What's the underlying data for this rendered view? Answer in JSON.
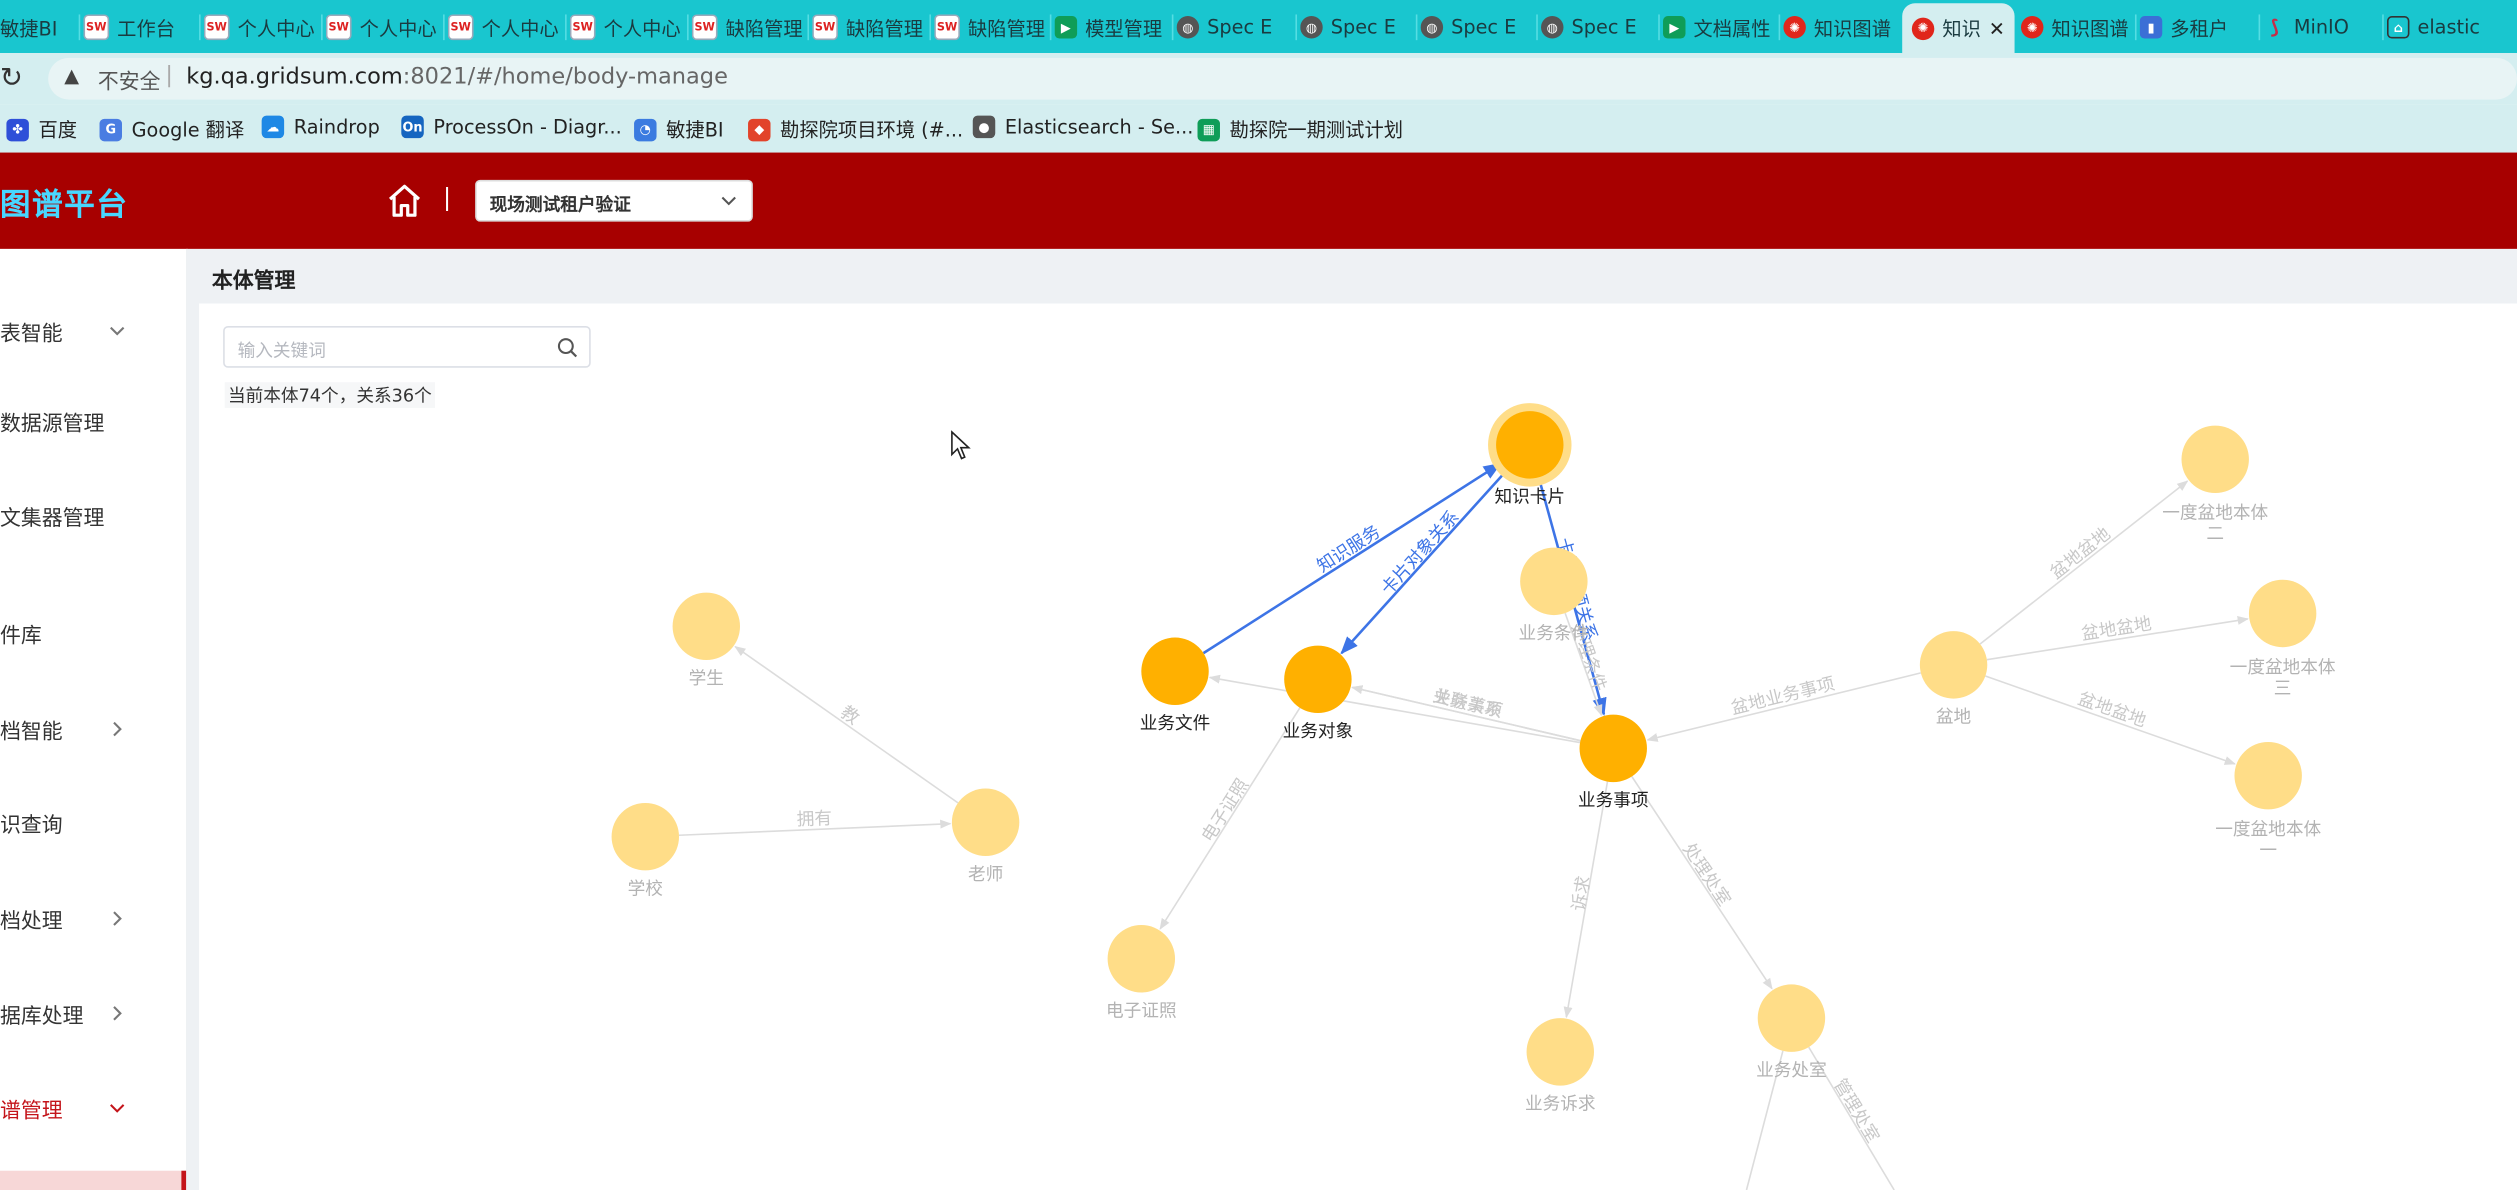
{
  "browser": {
    "tabs": [
      {
        "label": "敏捷BI",
        "icon": "bi-icon"
      },
      {
        "label": "工作台",
        "icon": "gridsum-icon"
      },
      {
        "label": "个人中心",
        "icon": "gridsum-icon"
      },
      {
        "label": "个人中心",
        "icon": "gridsum-icon"
      },
      {
        "label": "个人中心",
        "icon": "gridsum-icon"
      },
      {
        "label": "个人中心",
        "icon": "gridsum-icon"
      },
      {
        "label": "缺陷管理",
        "icon": "gridsum-icon"
      },
      {
        "label": "缺陷管理",
        "icon": "gridsum-icon"
      },
      {
        "label": "缺陷管理",
        "icon": "gridsum-icon"
      },
      {
        "label": "模型管理",
        "icon": "play-icon"
      },
      {
        "label": "Spec E",
        "icon": "globe-icon"
      },
      {
        "label": "Spec E",
        "icon": "globe-icon"
      },
      {
        "label": "Spec E",
        "icon": "globe-icon"
      },
      {
        "label": "Spec E",
        "icon": "globe-icon"
      },
      {
        "label": "文档属性",
        "icon": "play-icon"
      },
      {
        "label": "知识图谱",
        "icon": "petrochina-icon"
      },
      {
        "label": "知识",
        "icon": "petrochina-icon",
        "active": true
      },
      {
        "label": "知识图谱",
        "icon": "petrochina-icon"
      },
      {
        "label": "多租户",
        "icon": "bars-icon"
      },
      {
        "label": "MinIO",
        "icon": "minio-icon"
      },
      {
        "label": "elastic",
        "icon": "elastic-icon"
      }
    ],
    "close_glyph": "✕",
    "reload_glyph": "↻",
    "warning_glyph": "▲",
    "insecure_label": "不安全",
    "url_host": "kg.qa.gridsum.com",
    "url_rest": ":8021/#/home/body-manage",
    "bookmarks": [
      {
        "label": "百度",
        "icon": "baidu-icon"
      },
      {
        "label": "Google 翻译",
        "icon": "google-translate-icon"
      },
      {
        "label": "Raindrop",
        "icon": "raindrop-icon"
      },
      {
        "label": "ProcessOn - Diagr...",
        "icon": "processon-icon"
      },
      {
        "label": "敏捷BI",
        "icon": "bi-icon"
      },
      {
        "label": "勘探院项目环境 (#...",
        "icon": "gitlab-icon"
      },
      {
        "label": "Elasticsearch - Se...",
        "icon": "elasticsearch-icon"
      },
      {
        "label": "勘探院一期测试计划",
        "icon": "sheets-icon"
      }
    ]
  },
  "app": {
    "brand": "图谱平台",
    "home_separator": "|",
    "tenant_selected": "现场测试租户验证"
  },
  "sidebar": {
    "items": [
      {
        "label": "表智能",
        "arrow": "down"
      },
      {
        "label": "数据源管理",
        "arrow": ""
      },
      {
        "label": "文集器管理",
        "arrow": ""
      },
      {
        "label": "件库",
        "arrow": ""
      },
      {
        "label": "档智能",
        "arrow": "right"
      },
      {
        "label": "识查询",
        "arrow": ""
      },
      {
        "label": "档处理",
        "arrow": "right"
      },
      {
        "label": "据库处理",
        "arrow": "right"
      },
      {
        "label": "谱管理",
        "arrow": "down",
        "active": true
      }
    ]
  },
  "main": {
    "page_title": "本体管理",
    "search_placeholder": "输入关键词",
    "count_text": "当前本体74个，关系36个"
  },
  "colors": {
    "header_red": "#a70000",
    "brand_cyan": "#48d7ff",
    "node_active": "#ffb000",
    "node_faded": "#ffdd88",
    "edge_active": "#3d74e6",
    "edge_faded": "#dcdcdc",
    "sidebar_active": "#c4141a"
  },
  "graph": {
    "nodes": [
      {
        "id": "card",
        "label": "知识卡片",
        "active": true,
        "selected": true
      },
      {
        "id": "file",
        "label": "业务文件",
        "active": true
      },
      {
        "id": "object",
        "label": "业务对象",
        "active": true
      },
      {
        "id": "matter",
        "label": "业务事项",
        "active": true
      },
      {
        "id": "condition",
        "label": "业务条件",
        "active": false
      },
      {
        "id": "student",
        "label": "学生",
        "active": false
      },
      {
        "id": "school",
        "label": "学校",
        "active": false
      },
      {
        "id": "teacher",
        "label": "老师",
        "active": false
      },
      {
        "id": "cert",
        "label": "电子证照",
        "active": false
      },
      {
        "id": "appeal",
        "label": "业务诉求",
        "active": false
      },
      {
        "id": "office",
        "label": "业务处室",
        "active": false
      },
      {
        "id": "basin",
        "label": "盆地",
        "active": false
      },
      {
        "id": "basin1",
        "label": "一度盆地本体一",
        "active": false
      },
      {
        "id": "basin2",
        "label": "一度盆地本体二",
        "active": false
      },
      {
        "id": "basin3",
        "label": "一度盆地本体三",
        "active": false
      }
    ],
    "edges": [
      {
        "id": "e1",
        "label": "知识服务",
        "active": true
      },
      {
        "id": "e2",
        "label": "卡片对象关系",
        "active": true
      },
      {
        "id": "e3",
        "label": "卡片事项关系",
        "active": true
      },
      {
        "id": "e4",
        "label": "",
        "active": false
      },
      {
        "id": "e5",
        "label": "业务关系",
        "active": false
      },
      {
        "id": "e6",
        "label": "关联事项",
        "active": false
      },
      {
        "id": "e7",
        "label": "办理条件",
        "active": false
      },
      {
        "id": "e8",
        "label": "电子证照",
        "active": false
      },
      {
        "id": "e9",
        "label": "诉求",
        "active": false
      },
      {
        "id": "e10",
        "label": "处理处室",
        "active": false
      },
      {
        "id": "e11",
        "label": "盆地业务事项",
        "active": false
      },
      {
        "id": "e12",
        "label": "盆地盆地",
        "active": false
      },
      {
        "id": "e13",
        "label": "盆地盆地",
        "active": false
      },
      {
        "id": "e14",
        "label": "盆地盆地",
        "active": false
      },
      {
        "id": "e15",
        "label": "拥有",
        "active": false
      },
      {
        "id": "e16",
        "label": "教",
        "active": false
      },
      {
        "id": "e17",
        "label": "",
        "active": false
      },
      {
        "id": "e18",
        "label": "管理处室",
        "active": false
      }
    ]
  }
}
